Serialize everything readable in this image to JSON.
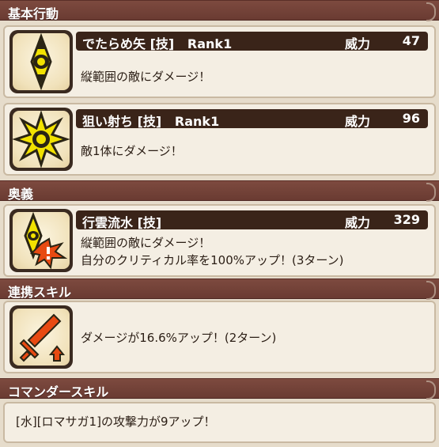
{
  "sections": {
    "basic": "基本行動",
    "secret": "奥義",
    "link": "連携スキル",
    "commander": "コマンダースキル"
  },
  "skills": [
    {
      "name": "でたらめ矢 [技]",
      "rank": "Rank1",
      "stat_label": "威力",
      "stat_value": "47",
      "desc": [
        "縦範囲の敵にダメージ！"
      ],
      "icon": "vertical-range-icon"
    },
    {
      "name": "狙い射ち [技]",
      "rank": "Rank1",
      "stat_label": "威力",
      "stat_value": "96",
      "desc": [
        "敵1体にダメージ！"
      ],
      "icon": "single-target-burst-icon"
    }
  ],
  "secret_skill": {
    "name": "行雲流水 [技]",
    "stat_label": "威力",
    "stat_value": "329",
    "desc": [
      "縦範囲の敵にダメージ！",
      "自分のクリティカル率を100%アップ！(3ターン)"
    ],
    "icon": "vertical-range-crit-icon"
  },
  "link_skill": {
    "desc": "ダメージが16.6%アップ！(2ターン)",
    "icon": "sword-attack-up-icon"
  },
  "commander_skill": {
    "desc": "[水][ロマサガ1]の攻撃力が9アップ！"
  }
}
